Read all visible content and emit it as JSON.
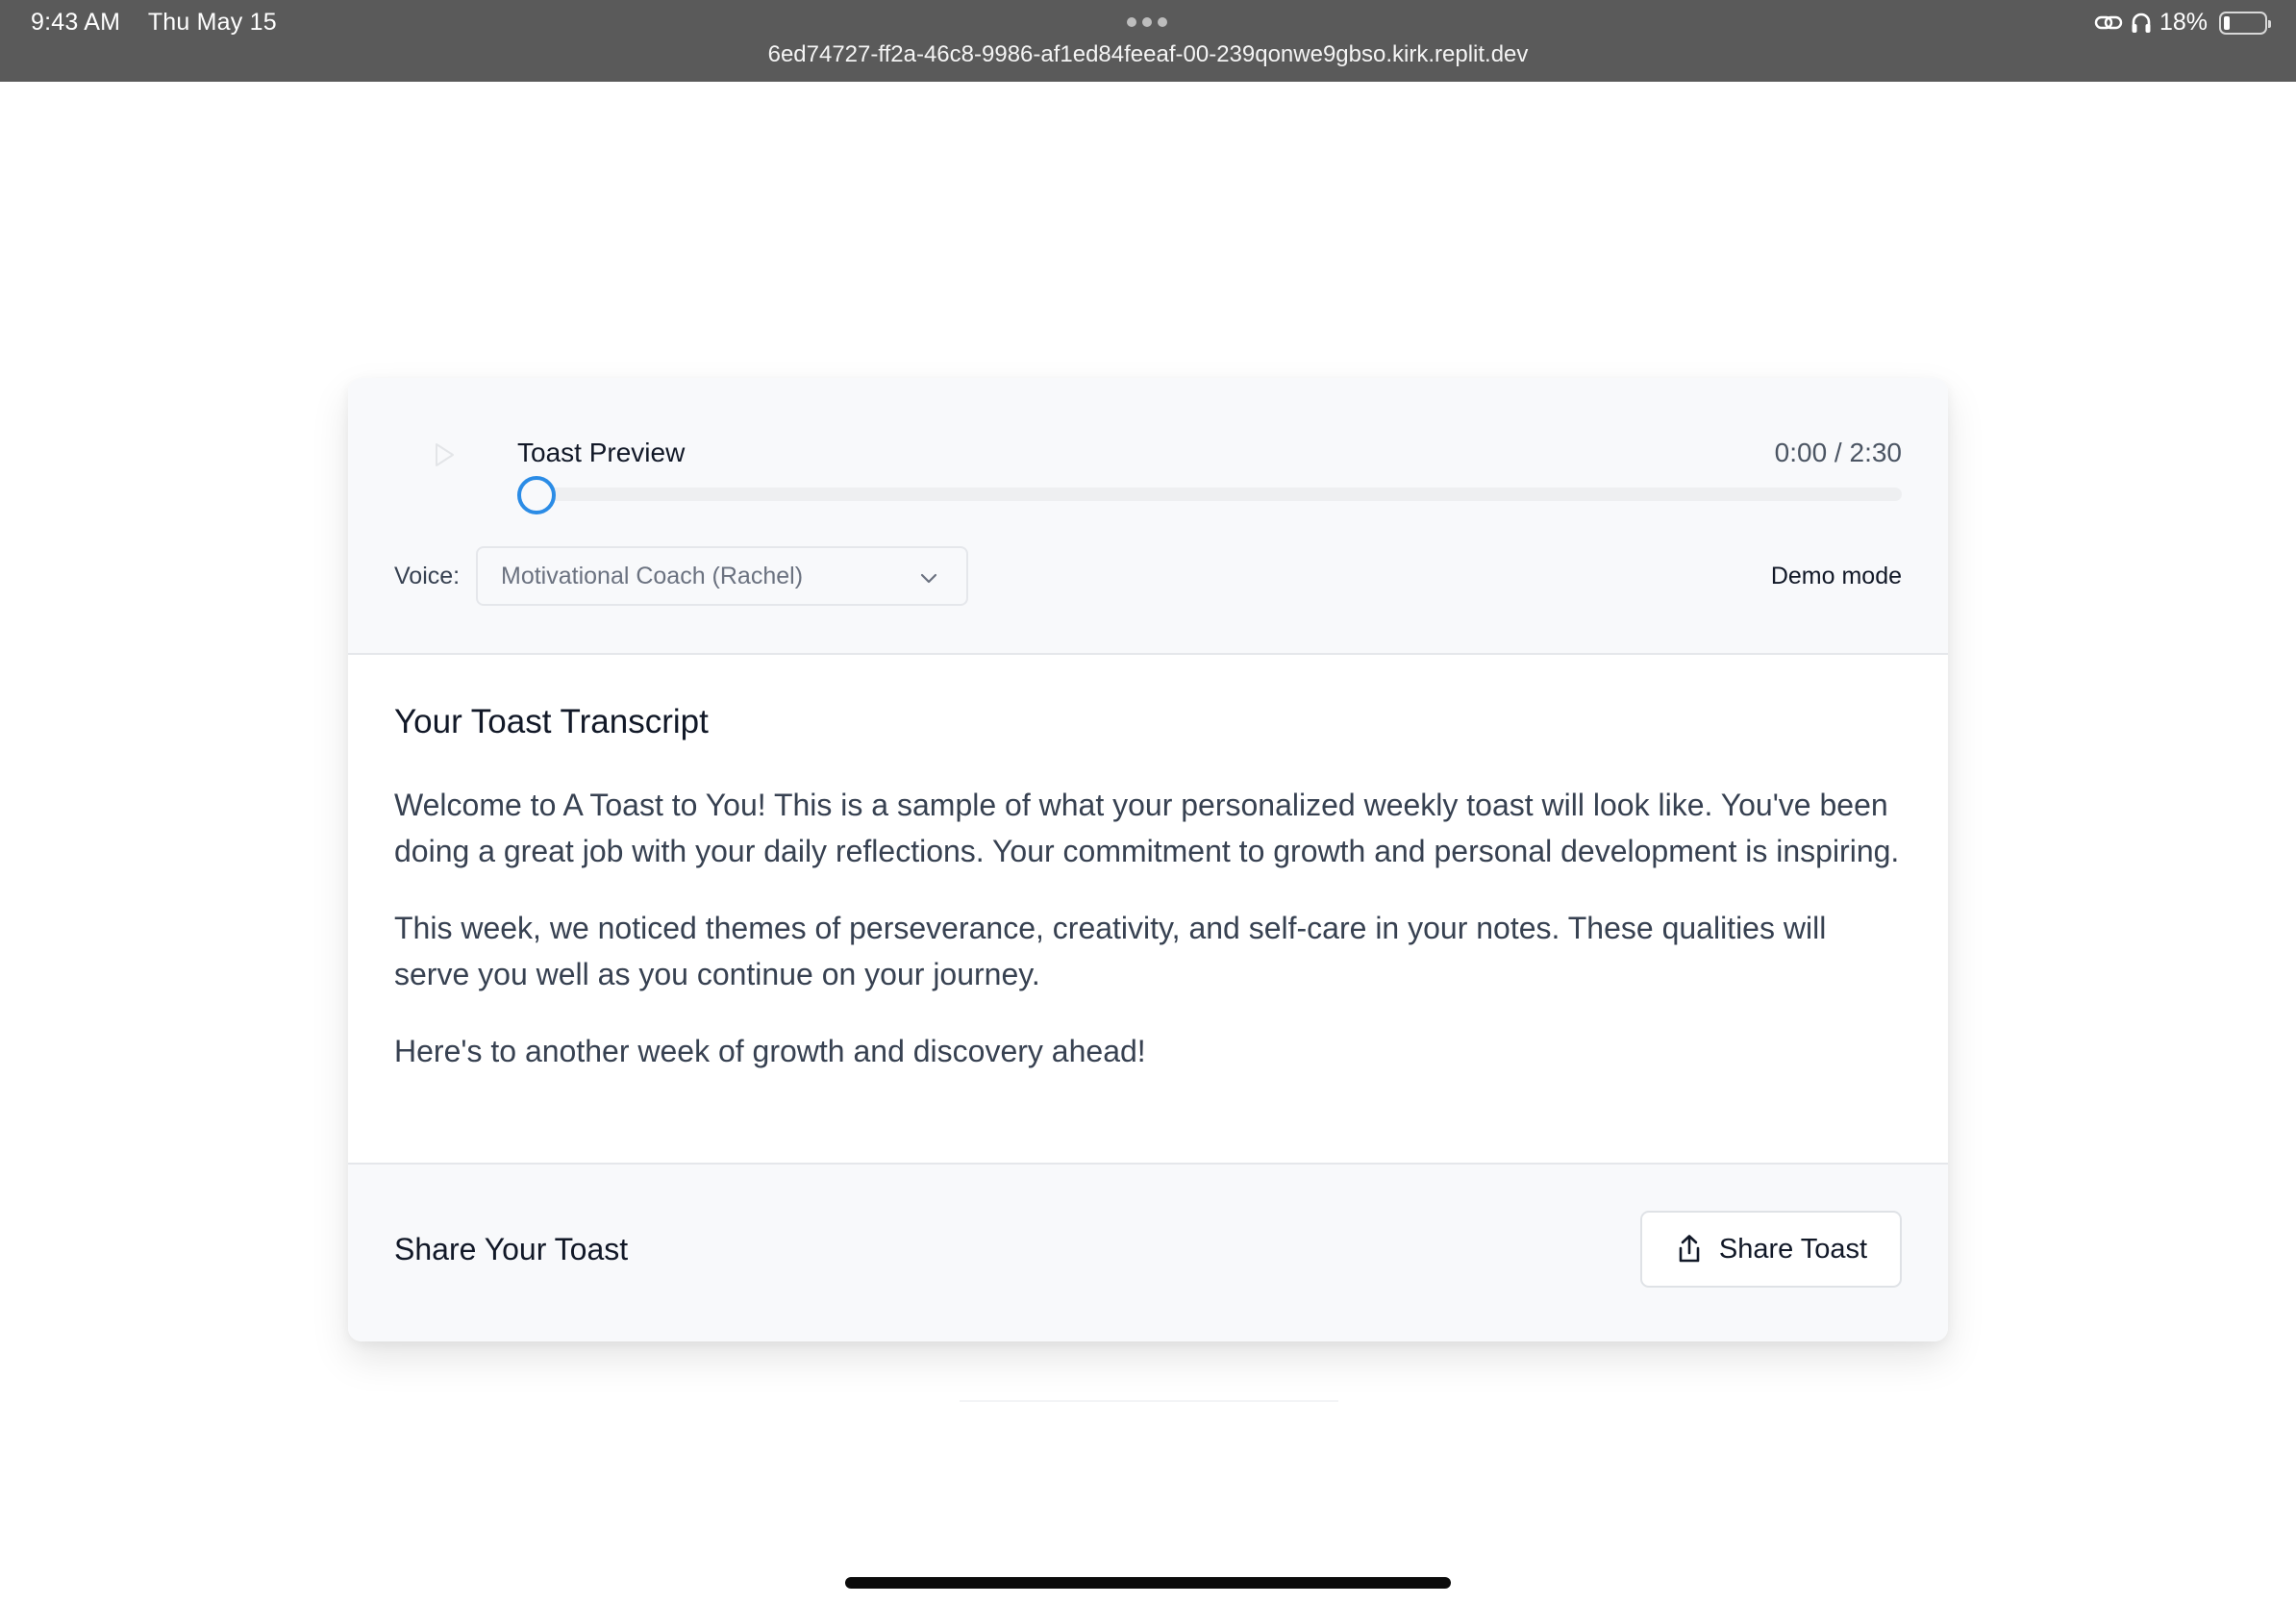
{
  "status_bar": {
    "time": "9:43 AM",
    "date": "Thu May 15",
    "url": "6ed74727-ff2a-46c8-9986-af1ed84feeaf-00-239qonwe9gbso.kirk.replit.dev",
    "battery": "18%",
    "icons": [
      "link-icon",
      "headphones-icon",
      "battery-icon"
    ]
  },
  "player": {
    "title": "Toast Preview",
    "time": "0:00 / 2:30",
    "progress": 0,
    "voice_label": "Voice:",
    "voice_value": "Motivational Coach (Rachel)",
    "mode": "Demo mode",
    "accent_color": "#2b8ce6"
  },
  "transcript": {
    "heading": "Your Toast Transcript",
    "paragraphs": [
      "Welcome to A Toast to You! This is a sample of what your personalized weekly toast will look like. You've been doing a great job with your daily reflections. Your commitment to growth and personal development is inspiring.",
      "This week, we noticed themes of perseverance, creativity, and self-care in your notes. These qualities will serve you well as you continue on your journey.",
      "Here's to another week of growth and discovery ahead!"
    ]
  },
  "share": {
    "title": "Share Your Toast",
    "button_label": "Share Toast"
  }
}
